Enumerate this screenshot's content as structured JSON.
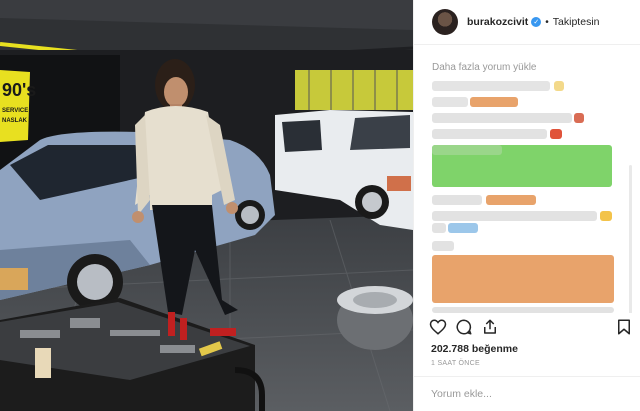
{
  "post": {
    "username": "burakozcivit",
    "follow_label": "Takiptesin",
    "load_more_label": "Daha fazla yorum yükle",
    "likes_text": "202.788 beğenme",
    "timestamp": "1 SAAT ÖNCE",
    "comment_placeholder": "Yorum ekle...",
    "photo_sign_lines": [
      "90's",
      "SERVICE",
      "NASLAK"
    ]
  },
  "icons": {
    "like": "heart-icon",
    "comment": "comment-icon",
    "share": "share-icon",
    "save": "bookmark-icon",
    "verified": "verified-badge-icon"
  },
  "colors": {
    "accent": "#3897f0",
    "blur_orange": "#e8a36b",
    "blur_green": "#7fd36a",
    "blur_blue": "#9cc7ea",
    "blur_gray": "#d8d8d8",
    "blur_yellow": "#f3c34a",
    "blur_red": "#e0533a"
  }
}
